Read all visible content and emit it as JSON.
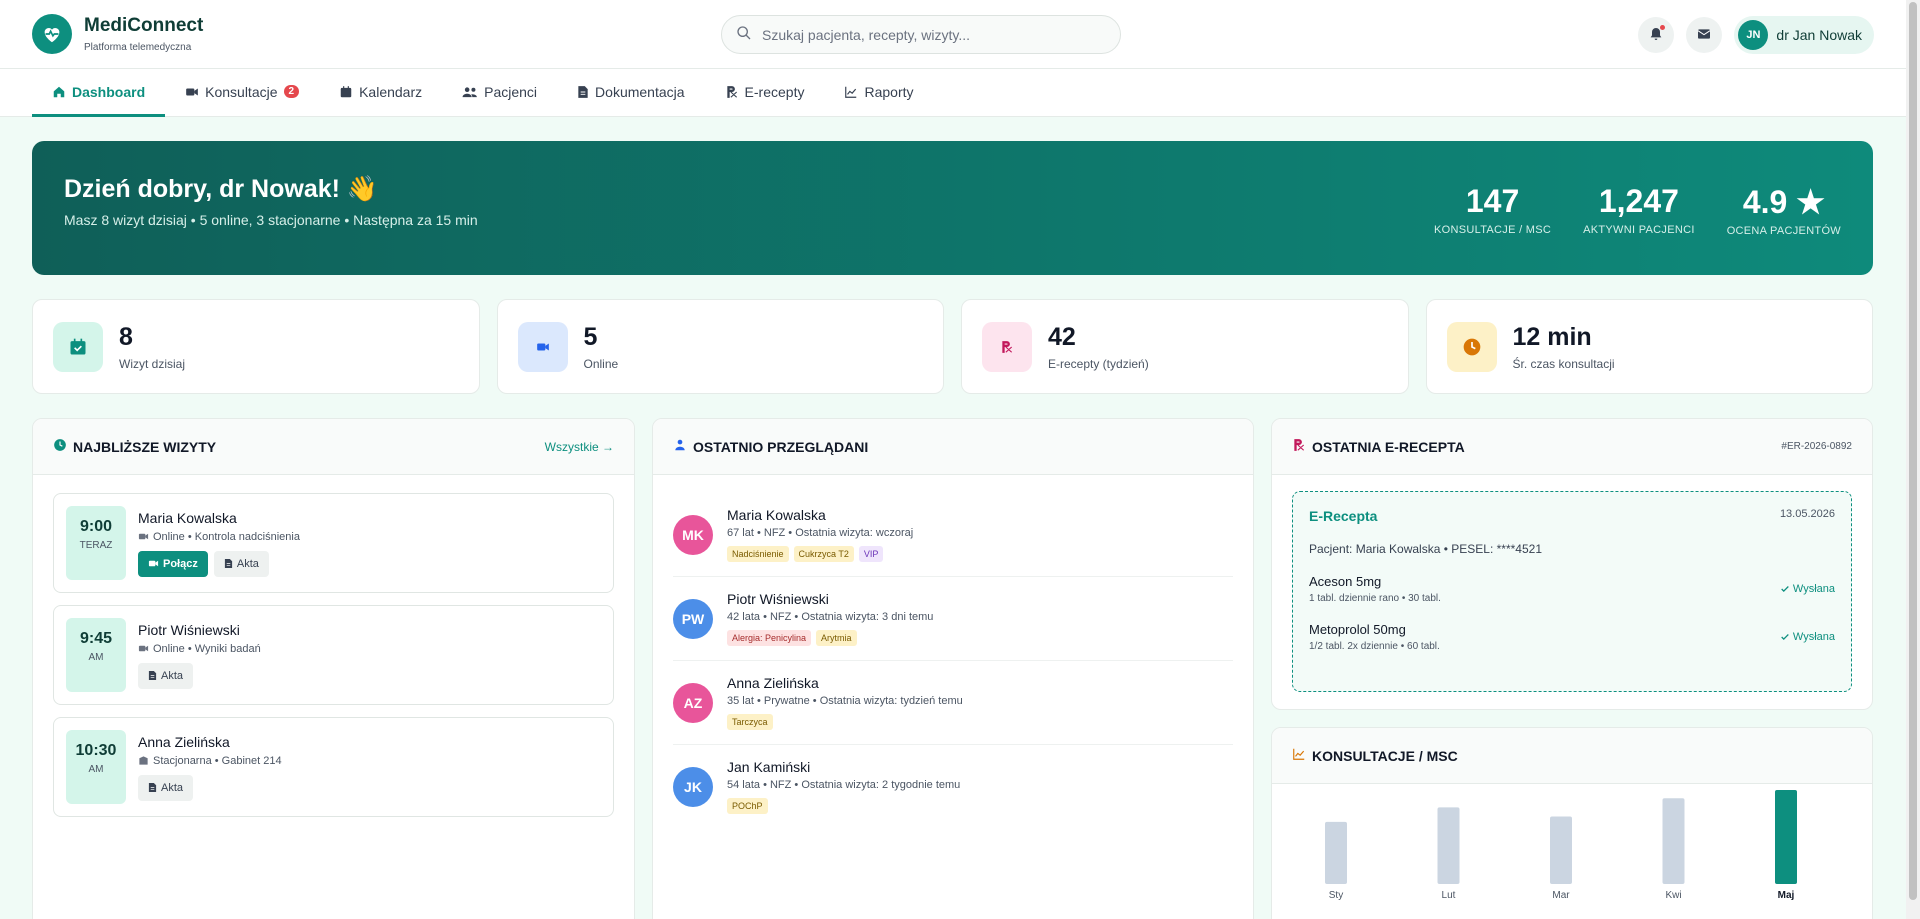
{
  "app": {
    "name": "MediConnect",
    "subtitle": "Platforma telemedyczna"
  },
  "search": {
    "placeholder": "Szukaj pacjenta, recepty, wizyty..."
  },
  "user": {
    "initials": "JN",
    "name": "dr Jan Nowak"
  },
  "nav": [
    {
      "label": "Dashboard",
      "icon": "home-icon",
      "active": true
    },
    {
      "label": "Konsultacje",
      "icon": "video-icon",
      "badge": "2"
    },
    {
      "label": "Kalendarz",
      "icon": "calendar-icon"
    },
    {
      "label": "Pacjenci",
      "icon": "users-icon"
    },
    {
      "label": "Dokumentacja",
      "icon": "file-icon"
    },
    {
      "label": "E-recepty",
      "icon": "rx-icon"
    },
    {
      "label": "Raporty",
      "icon": "chart-icon"
    }
  ],
  "hero": {
    "greeting": "Dzień dobry, dr Nowak! 👋",
    "summary": "Masz 8 wizyt dzisiaj • 5 online, 3 stacjonarne • Następna za 15 min",
    "stats": [
      {
        "value": "147",
        "label": "KONSULTACJE / MSC"
      },
      {
        "value": "1,247",
        "label": "AKTYWNI PACJENCI"
      },
      {
        "value": "4.9 ★",
        "label": "OCENA PACJENTÓW"
      }
    ]
  },
  "stat_cards": [
    {
      "value": "8",
      "label": "Wizyt dzisiaj",
      "icon": "calendar-check-icon",
      "bg": "#d4f5ea",
      "fg": "#0d8f7f"
    },
    {
      "value": "5",
      "label": "Online",
      "icon": "video-icon",
      "bg": "#dbe8fd",
      "fg": "#2563eb"
    },
    {
      "value": "42",
      "label": "E-recepty (tydzień)",
      "icon": "rx-icon",
      "bg": "#fde4ee",
      "fg": "#c2185b"
    },
    {
      "value": "12 min",
      "label": "Śr. czas konsultacji",
      "icon": "clock-icon",
      "bg": "#fdf1c7",
      "fg": "#d97706"
    }
  ],
  "visits_panel": {
    "title": "NAJBLIŻSZE WIZYTY",
    "link": "Wszystkie →",
    "visits": [
      {
        "time": "9:00",
        "period": "TERAZ",
        "name": "Maria Kowalska",
        "mode": "Online",
        "reason": "Kontrola nadciśnienia",
        "detail": "Online • Kontrola nadciśnienia",
        "connect": "Połącz",
        "files": "Akta"
      },
      {
        "time": "9:45",
        "period": "AM",
        "name": "Piotr Wiśniewski",
        "detail": "Online • Wyniki badań",
        "files": "Akta"
      },
      {
        "time": "10:30",
        "period": "AM",
        "name": "Anna Zielińska",
        "detail": "Stacjonarna • Gabinet 214",
        "files": "Akta"
      }
    ]
  },
  "patients_panel": {
    "title": "OSTATNIO PRZEGLĄDANI",
    "patients": [
      {
        "initials": "MK",
        "color": "#e8559a",
        "name": "Maria Kowalska",
        "detail": "67 lat • NFZ • Ostatnia wizyta: wczoraj",
        "tags": [
          {
            "t": "Nadciśnienie",
            "k": "y"
          },
          {
            "t": "Cukrzyca T2",
            "k": "y"
          },
          {
            "t": "VIP",
            "k": "p"
          }
        ]
      },
      {
        "initials": "PW",
        "color": "#4c8ee8",
        "name": "Piotr Wiśniewski",
        "detail": "42 lata • NFZ • Ostatnia wizyta: 3 dni temu",
        "tags": [
          {
            "t": "Alergia: Penicylina",
            "k": "r"
          },
          {
            "t": "Arytmia",
            "k": "y"
          }
        ]
      },
      {
        "initials": "AZ",
        "color": "#e8559a",
        "name": "Anna Zielińska",
        "detail": "35 lat • Prywatne • Ostatnia wizyta: tydzień temu",
        "tags": [
          {
            "t": "Tarczyca",
            "k": "y"
          }
        ]
      },
      {
        "initials": "JK",
        "color": "#4c8ee8",
        "name": "Jan Kamiński",
        "detail": "54 lata • NFZ • Ostatnia wizyta: 2 tygodnie temu",
        "tags": [
          {
            "t": "POChP",
            "k": "y"
          }
        ]
      }
    ]
  },
  "rx_panel": {
    "title": "OSTATNIA E-RECEPTA",
    "code": "#ER-2026-0892",
    "rx_title": "E-Recepta",
    "date": "13.05.2026",
    "patient": "Pacjent: Maria Kowalska • PESEL: ****4521",
    "meds": [
      {
        "name": "Aceson 5mg",
        "dose": "1 tabl. dziennie rano • 30 tabl.",
        "status": "Wysłana"
      },
      {
        "name": "Metoprolol 50mg",
        "dose": "1/2 tabl. 2x dziennie • 60 tabl.",
        "status": "Wysłana"
      }
    ]
  },
  "consult_panel": {
    "title": "KONSULTACJE / MSC"
  },
  "chart_data": {
    "type": "bar",
    "categories": [
      "Sty",
      "Lut",
      "Mar",
      "Kwi",
      "Maj"
    ],
    "values": [
      112,
      128,
      118,
      138,
      147
    ],
    "highlight": "Maj",
    "colors": {
      "normal": "#cbd5e1",
      "highlight": "#0d8f7f"
    }
  }
}
